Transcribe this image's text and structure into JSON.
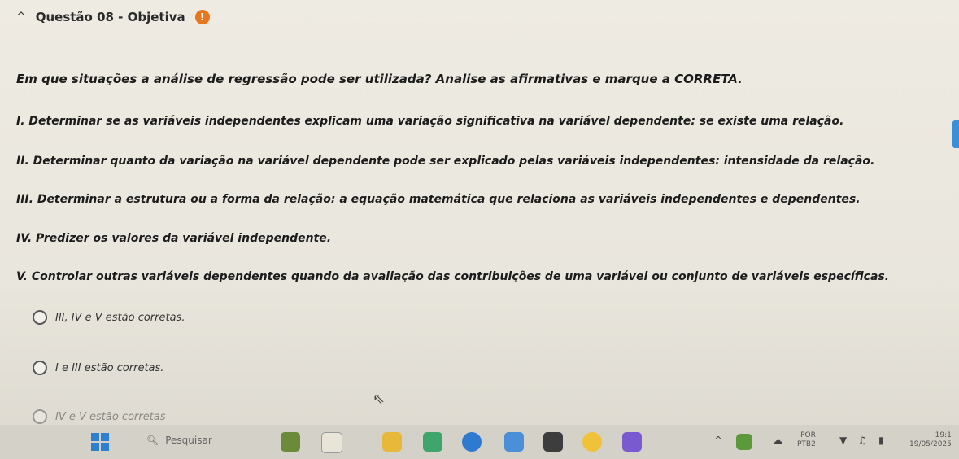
{
  "question": {
    "title": "Questão 08 - Objetiva",
    "prompt": "Em que situações a análise de regressão pode ser utilizada? Analise as afirmativas e marque a CORRETA.",
    "statements": [
      "I. Determinar se as variáveis independentes explicam uma variação significativa na variável dependente: se existe uma relação.",
      "II. Determinar quanto da variação na variável dependente pode ser explicado pelas variáveis independentes: intensidade da relação.",
      "III. Determinar a estrutura ou a forma da relação: a equação matemática que relaciona as variáveis independentes e dependentes.",
      "IV. Predizer os valores da variável independente.",
      "V. Controlar outras variáveis dependentes quando da avaliação das contribuições de uma variável ou conjunto de variáveis específicas."
    ],
    "options": [
      "III, IV e V estão corretas.",
      "I e III estão corretas.",
      "IV e V estão corretas"
    ]
  },
  "taskbar": {
    "search_placeholder": "Pesquisar",
    "tray_label_top": "POR",
    "tray_label_bottom": "PTB2",
    "time": "19:1",
    "date": "19/05/2025"
  },
  "colors": {
    "alert": "#e8761a",
    "accent": "#3a8fd8"
  }
}
